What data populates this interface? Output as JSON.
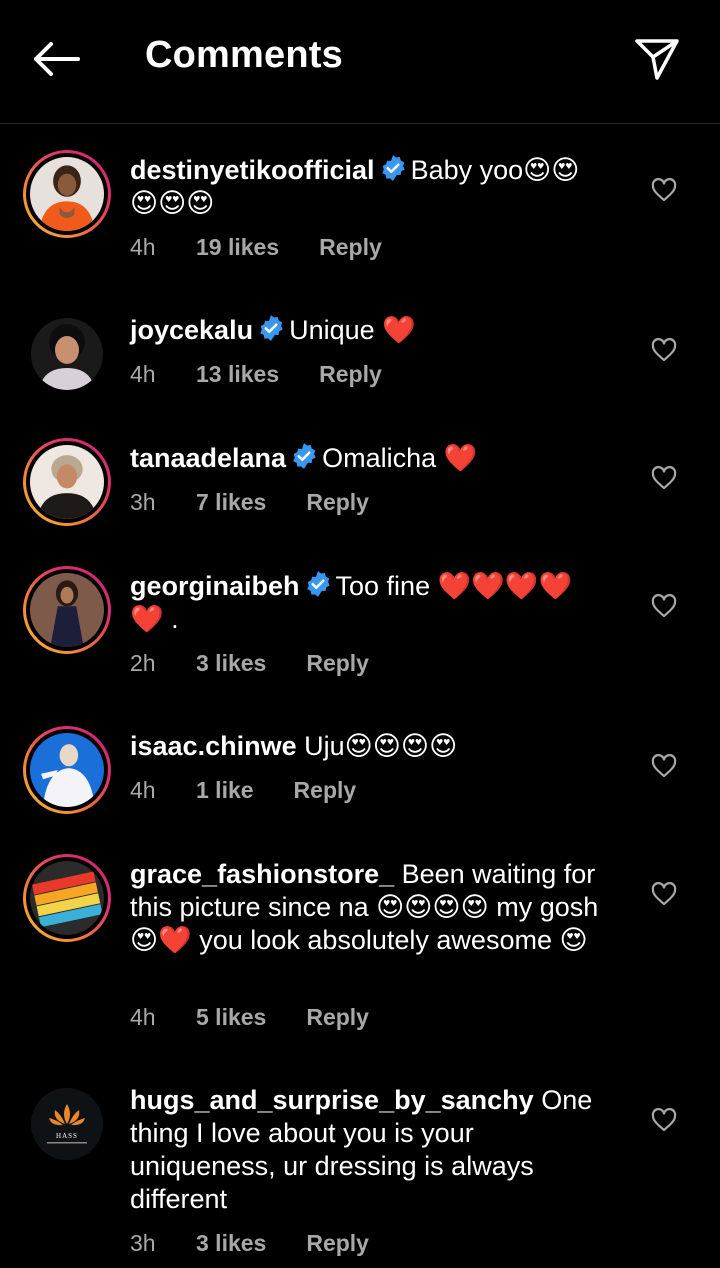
{
  "header": {
    "title": "Comments",
    "back_icon": "arrow-left-icon",
    "send_icon": "paper-plane-icon"
  },
  "colors": {
    "background": "#000000",
    "meta_gray": "#a8a8a8",
    "verified_blue": "#3897f0",
    "heart_red": "#ff3040"
  },
  "comments": [
    {
      "username": "destinyetikoofficial",
      "verified": true,
      "text": "Baby yoo😍😍😍😍😍",
      "time": "4h",
      "likes": "19 likes",
      "reply": "Reply",
      "story_ring": true
    },
    {
      "username": "joycekalu",
      "verified": true,
      "text": "Unique ❤️",
      "time": "4h",
      "likes": "13 likes",
      "reply": "Reply",
      "story_ring": false
    },
    {
      "username": "tanaadelana",
      "verified": true,
      "text": "Omalicha ❤️",
      "time": "3h",
      "likes": "7 likes",
      "reply": "Reply",
      "story_ring": true
    },
    {
      "username": "georginaibeh",
      "verified": true,
      "text": "Too fine ❤️❤️❤️❤️❤️ .",
      "time": "2h",
      "likes": "3 likes",
      "reply": "Reply",
      "story_ring": true
    },
    {
      "username": "isaac.chinwe",
      "verified": false,
      "text": "Uju😍😍😍😍",
      "time": "4h",
      "likes": "1 like",
      "reply": "Reply",
      "story_ring": true
    },
    {
      "username": "grace_fashionstore_",
      "verified": false,
      "text": "Been waiting for this picture since na 😍😍😍😍 my gosh 😍❤️ you look absolutely awesome 😍",
      "time": "4h",
      "likes": "5 likes",
      "reply": "Reply",
      "story_ring": true
    },
    {
      "username": "hugs_and_surprise_by_sanchy",
      "verified": false,
      "text": "One thing I love about you is your uniqueness, ur dressing is always different",
      "time": "3h",
      "likes": "3 likes",
      "reply": "Reply",
      "story_ring": false,
      "avatar_logo_text": "HASS"
    }
  ]
}
